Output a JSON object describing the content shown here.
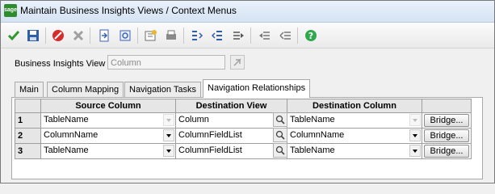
{
  "window": {
    "app_icon_text": "sage",
    "title": "Maintain Business Insights Views / Context Menus"
  },
  "toolbar": {
    "icons": [
      "check-icon",
      "save-icon",
      "delete-icon",
      "cancel-x-icon",
      "export-icon",
      "import-icon",
      "properties-icon",
      "print-icon",
      "insert-rows-icon",
      "delete-rows-icon",
      "indent-icon",
      "outdent-icon",
      "up-icon",
      "help-icon"
    ]
  },
  "form": {
    "view_label": "Business Insights View",
    "view_value": "Column"
  },
  "tabs": [
    {
      "label": "Main",
      "active": false
    },
    {
      "label": "Column Mapping",
      "active": false
    },
    {
      "label": "Navigation Tasks",
      "active": false
    },
    {
      "label": "Navigation Relationships",
      "active": true
    }
  ],
  "grid": {
    "headers": [
      "Source Column",
      "Destination View",
      "Destination Column"
    ],
    "rows": [
      {
        "num": "1",
        "source": "TableName",
        "dest_view": "Column",
        "dest_column": "TableName",
        "bridge": "Bridge..."
      },
      {
        "num": "2",
        "source": "ColumnName",
        "dest_view": "ColumnFieldList",
        "dest_column": "ColumnName",
        "bridge": "Bridge..."
      },
      {
        "num": "3",
        "source": "TableName",
        "dest_view": "ColumnFieldList",
        "dest_column": "TableName",
        "bridge": "Bridge..."
      }
    ]
  }
}
